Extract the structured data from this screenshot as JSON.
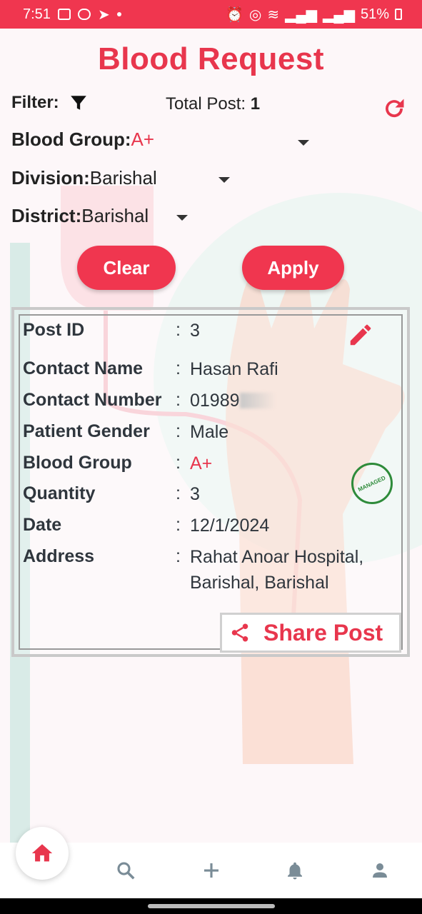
{
  "status": {
    "time": "7:51",
    "battery": "51%"
  },
  "page": {
    "title": "Blood Request"
  },
  "filter": {
    "label": "Filter:",
    "total_label": "Total Post:",
    "total_value": "1"
  },
  "selects": {
    "blood_group": {
      "label": "Blood Group:",
      "value": "A+"
    },
    "division": {
      "label": "Division:",
      "value": "Barishal"
    },
    "district": {
      "label": "District:",
      "value": "Barishal"
    }
  },
  "buttons": {
    "clear": "Clear",
    "apply": "Apply"
  },
  "post": {
    "fields": [
      {
        "key": "Post ID",
        "value": "3"
      },
      {
        "key": "Contact Name",
        "value": "Hasan Rafi"
      },
      {
        "key": "Contact Number",
        "value": "01989"
      },
      {
        "key": "Patient Gender",
        "value": "Male"
      },
      {
        "key": "Blood Group",
        "value": "A+"
      },
      {
        "key": "Quantity",
        "value": "3"
      },
      {
        "key": "Date",
        "value": "12/1/2024"
      },
      {
        "key": "Address",
        "value": "Rahat Anoar Hospital,",
        "value2": "Barishal, Barishal"
      }
    ],
    "colon": ":",
    "stamp": "MANAGED",
    "share_label": "Share Post"
  },
  "nav": {
    "items": [
      "home-icon",
      "search-icon",
      "add-icon",
      "bell-icon",
      "person-icon"
    ]
  },
  "colors": {
    "accent": "#f0364f",
    "stripe": "#d9ebe7"
  }
}
